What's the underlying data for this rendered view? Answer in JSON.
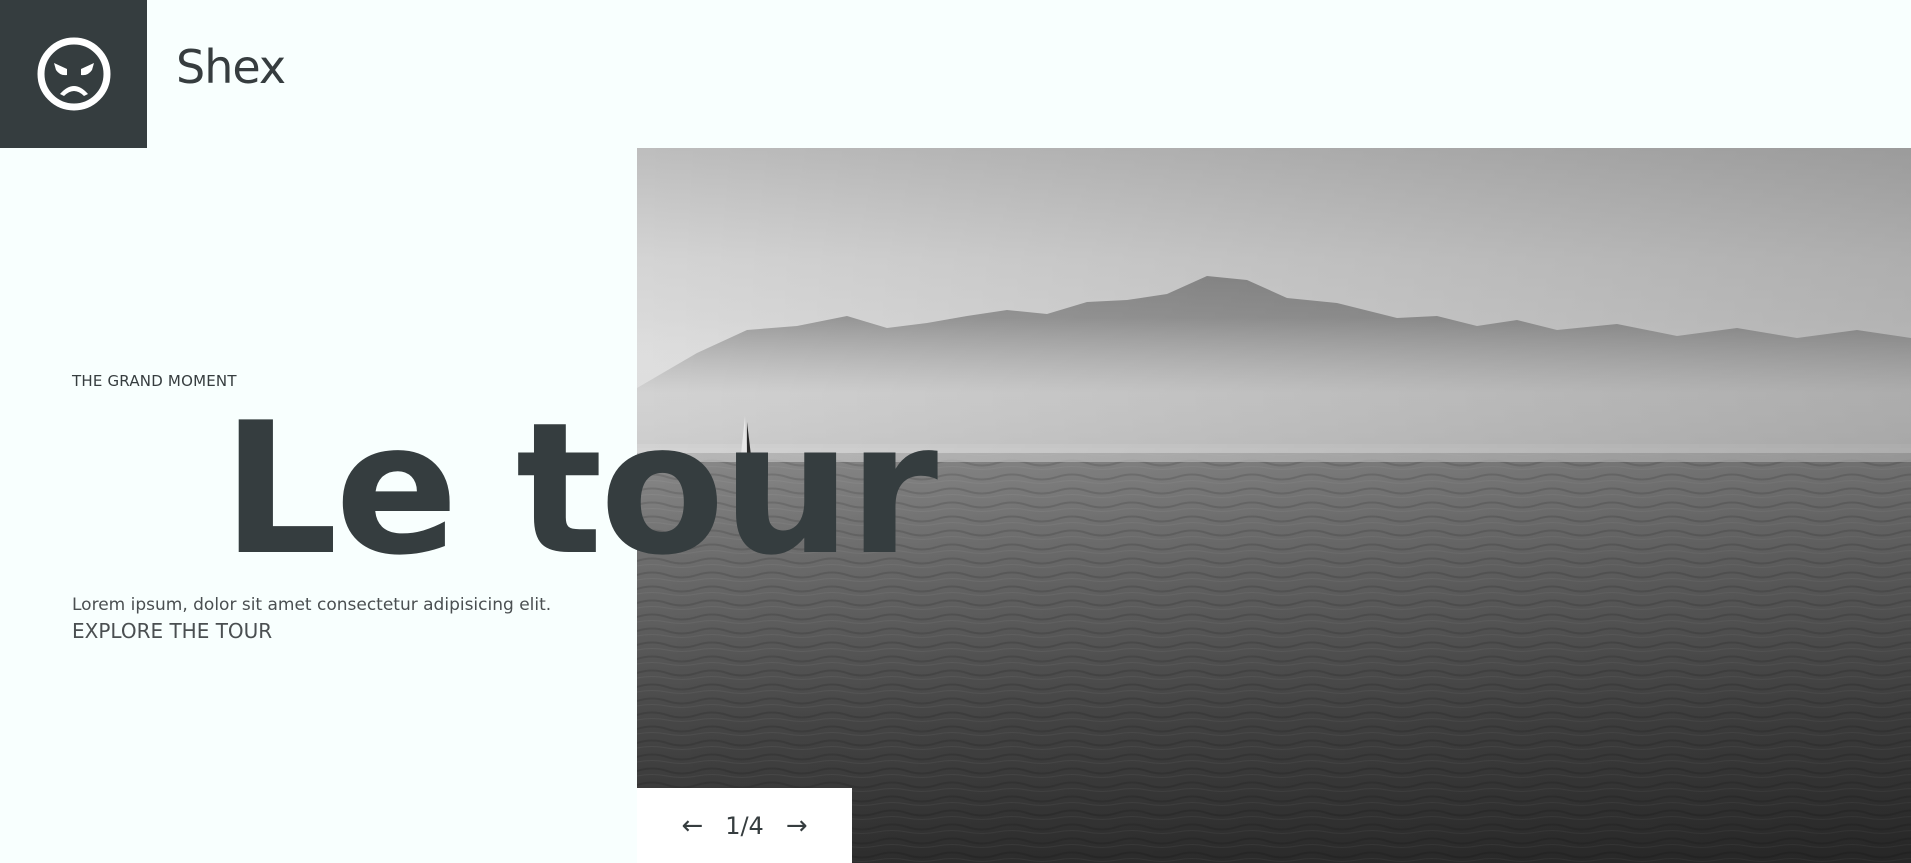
{
  "header": {
    "brand_name": "Shex",
    "logo_icon": "angry-face-icon",
    "logo_bg_color": "#353d3f"
  },
  "hero": {
    "eyebrow": "THE GRAND MOMENT",
    "headline": "Le tour",
    "description": "Lorem ipsum, dolor sit amet consectetur adipisicing elit.",
    "cta_label": "EXPLORE THE TOUR",
    "image_subject": "lake-with-mountains-and-sailboat"
  },
  "pager": {
    "prev_icon": "arrow-left-icon",
    "prev_glyph": "←",
    "counter": "1/4",
    "next_icon": "arrow-right-icon",
    "next_glyph": "→"
  },
  "colors": {
    "background": "#f8fffe",
    "text": "#363d3f",
    "accent_dark": "#353d3f"
  }
}
